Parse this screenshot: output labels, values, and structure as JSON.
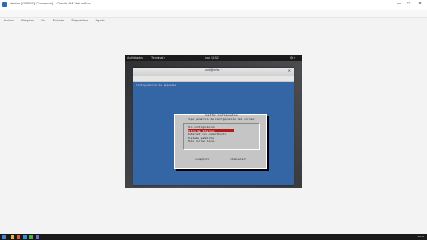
{
  "host": {
    "title": "debian [ORRIS] [Corriendo] - Oracle VM VirtualBox",
    "menu": [
      "Archivo",
      "Máquina",
      "Ver",
      "Entrada",
      "Dispositivos",
      "Ayuda"
    ],
    "controls": {
      "minimize": "—",
      "maximize": "□",
      "close": "✕"
    }
  },
  "guest": {
    "activities": "Actividades",
    "terminal_app": "Terminal ▾",
    "clock": "mar 18:52",
    "tray": "⚙ ▾"
  },
  "terminal": {
    "title": "root@orris: ~",
    "close": "✕",
    "menu": [
      "Archivo",
      "Editar",
      "Ver",
      "Buscar",
      "Terminal",
      "Ayuda"
    ],
    "header": "Configuración de paquetes"
  },
  "dialog": {
    "title": "Postfix Configuration",
    "subtitle": "Tipo genérico de configuración del correo:",
    "items": [
      "Sin configuración",
      "Sitio de Internet",
      "Internet con «smarthost»",
      "Sistema satélite",
      "Sólo correo local"
    ],
    "selected_index": 1,
    "ok": "<Aceptar>",
    "cancel": "<Cancelar>"
  },
  "taskbar": {
    "icon_colors": [
      "#e8b44a",
      "#e05a2b",
      "#3f8ad8",
      "#46b04a",
      "#6a6fd6"
    ],
    "clock": "18:52"
  }
}
